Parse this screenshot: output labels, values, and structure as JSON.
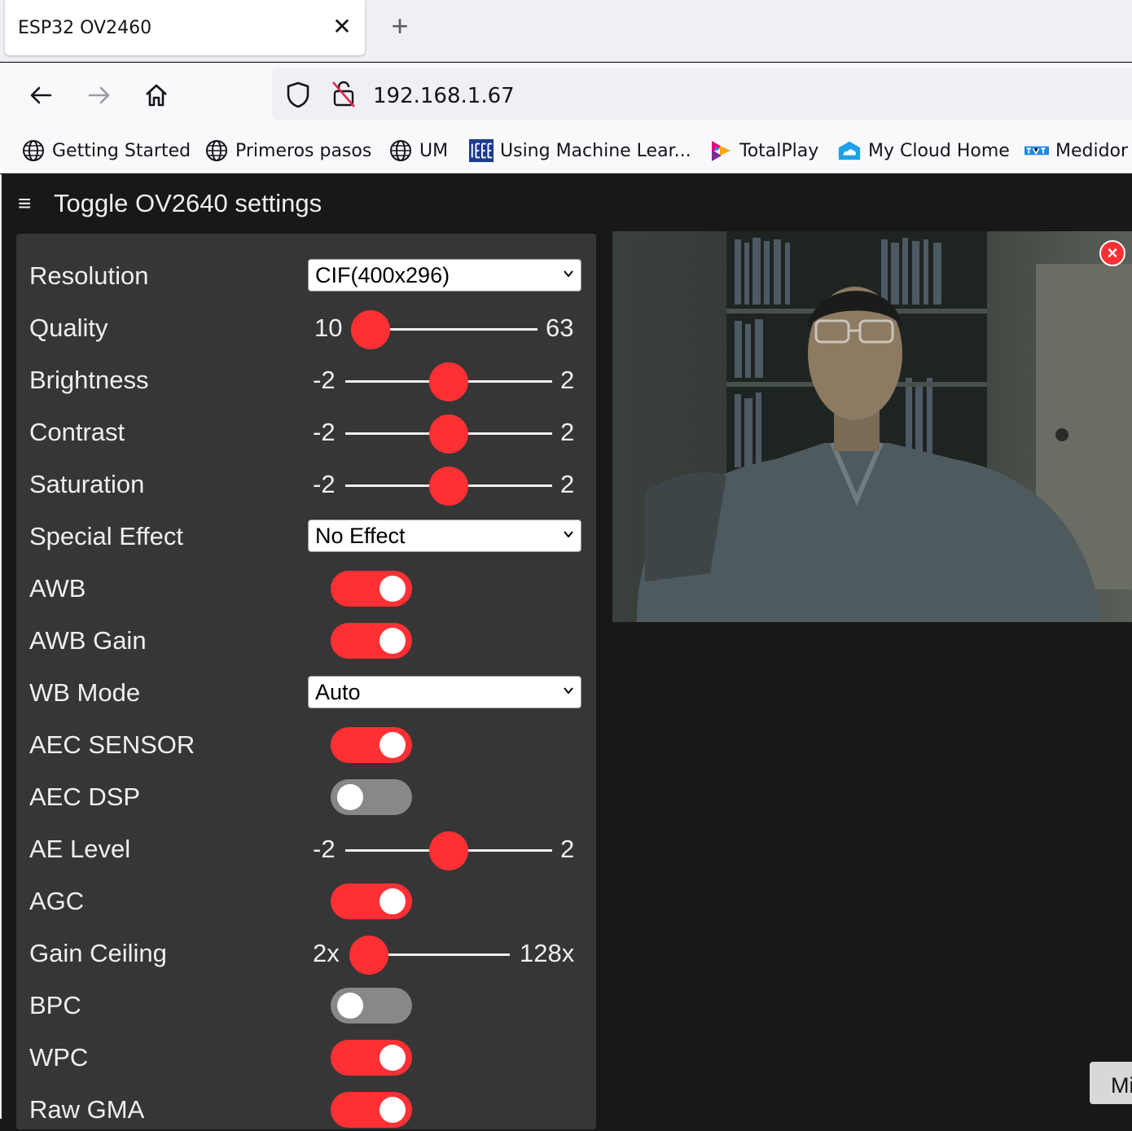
{
  "browser": {
    "tab_title": "ESP32 OV2460",
    "tab_close": "✕",
    "new_tab": "+",
    "url": "192.168.1.67"
  },
  "bookmarks": [
    {
      "label": "Getting Started",
      "icon": "globe-icon"
    },
    {
      "label": "Primeros pasos",
      "icon": "globe-icon"
    },
    {
      "label": "UM",
      "icon": "globe-icon"
    },
    {
      "label": "Using Machine Lear...",
      "icon": "ieee-icon"
    },
    {
      "label": "TotalPlay",
      "icon": "totalplay-icon"
    },
    {
      "label": "My Cloud Home",
      "icon": "cloud-icon"
    },
    {
      "label": "Medidor",
      "icon": "medidor-icon"
    }
  ],
  "page": {
    "hamburger": "≡",
    "title": "Toggle OV2640 settings",
    "close_stream": "×",
    "bottom_button": "Mi"
  },
  "settings": {
    "resolution": {
      "label": "Resolution",
      "value": "CIF(400x296)"
    },
    "quality": {
      "label": "Quality",
      "min": "10",
      "max": "63",
      "value": 10
    },
    "brightness": {
      "label": "Brightness",
      "min": "-2",
      "max": "2",
      "value": 0
    },
    "contrast": {
      "label": "Contrast",
      "min": "-2",
      "max": "2",
      "value": 0
    },
    "saturation": {
      "label": "Saturation",
      "min": "-2",
      "max": "2",
      "value": 0
    },
    "special_effect": {
      "label": "Special Effect",
      "value": "No Effect"
    },
    "awb": {
      "label": "AWB",
      "on": true
    },
    "awb_gain": {
      "label": "AWB Gain",
      "on": true
    },
    "wb_mode": {
      "label": "WB Mode",
      "value": "Auto"
    },
    "aec_sensor": {
      "label": "AEC SENSOR",
      "on": true
    },
    "aec_dsp": {
      "label": "AEC DSP",
      "on": false
    },
    "ae_level": {
      "label": "AE Level",
      "min": "-2",
      "max": "2",
      "value": 0
    },
    "agc": {
      "label": "AGC",
      "on": true
    },
    "gain_ceiling": {
      "label": "Gain Ceiling",
      "min": "2x",
      "max": "128x",
      "value": 0
    },
    "bpc": {
      "label": "BPC",
      "on": false
    },
    "wpc": {
      "label": "WPC",
      "on": true
    },
    "raw_gma": {
      "label": "Raw GMA",
      "on": true
    }
  },
  "colors": {
    "accent": "#ff3034",
    "panel": "#363636",
    "background": "#181818"
  }
}
